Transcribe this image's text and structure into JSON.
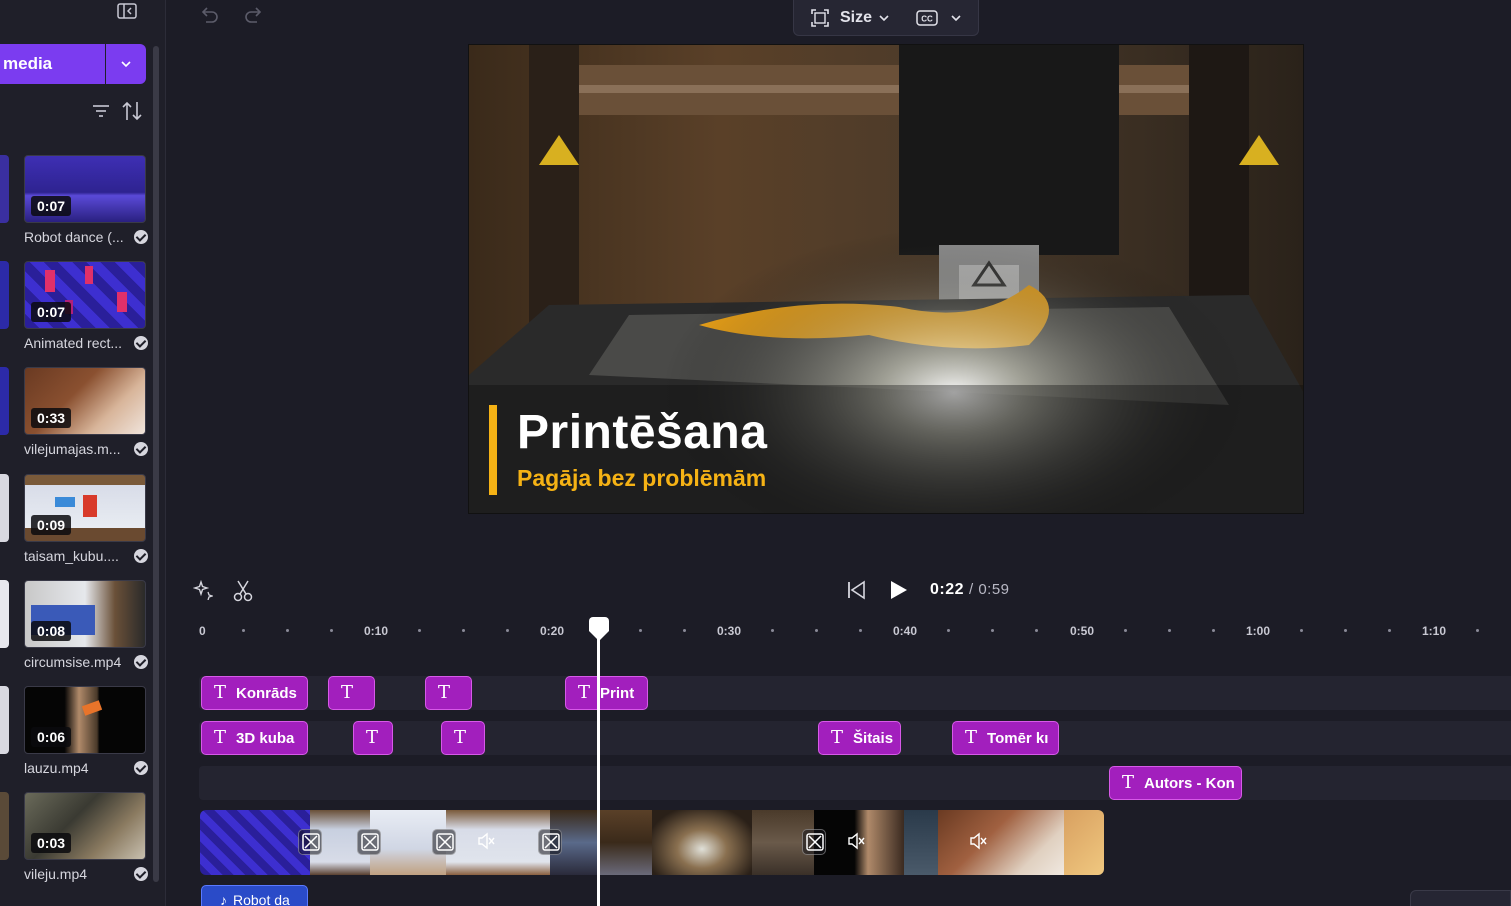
{
  "left_panel": {
    "media_button_label": "media",
    "items": [
      {
        "duration": "0:07",
        "name": "Robot dance (..."
      },
      {
        "duration": "0:07",
        "name": "Animated rect..."
      },
      {
        "duration": "0:33",
        "name": "vilejumajas.m..."
      },
      {
        "duration": "0:09",
        "name": "taisam_kubu...."
      },
      {
        "duration": "0:08",
        "name": "circumsise.mp4"
      },
      {
        "duration": "0:06",
        "name": "lauzu.mp4"
      },
      {
        "duration": "0:03",
        "name": "vileju.mp4"
      }
    ]
  },
  "toolbar": {
    "size_label": "Size"
  },
  "preview": {
    "title": "Printēšana",
    "subtitle": "Pagāja bez problēmām"
  },
  "transport": {
    "current_time": "0:22",
    "total_time": "/ 0:59"
  },
  "ruler": {
    "labels": [
      "0",
      "0:10",
      "0:20",
      "0:30",
      "0:40",
      "0:50",
      "1:00",
      "1:10"
    ]
  },
  "tracks": {
    "row1": [
      "Konrāds",
      "",
      "",
      "Print"
    ],
    "row2": [
      "3D kuba",
      "",
      "",
      "Šitais",
      "Tomēr kı"
    ],
    "row3": [
      "Autors - Kon"
    ],
    "audio": "Robot da"
  },
  "colors": {
    "accent": "#7b3cf0",
    "text_clip": "#a21fbd",
    "audio_clip": "#2a4bc8",
    "title_accent": "#f5b215"
  }
}
